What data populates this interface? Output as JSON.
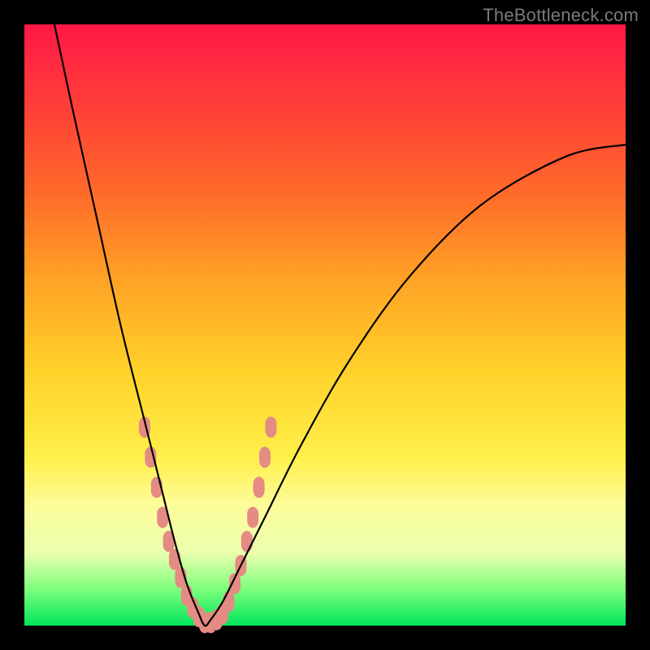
{
  "watermark": "TheBottleneck.com",
  "colors": {
    "gradient_top": "#ff1846",
    "gradient_bottom": "#00e55b",
    "curve": "#000000",
    "markers": "#e48b83",
    "frame": "#000000"
  },
  "chart_data": {
    "type": "line",
    "title": "",
    "xlabel": "",
    "ylabel": "",
    "xlim": [
      0,
      100
    ],
    "ylim": [
      0,
      100
    ],
    "note": "No numeric axis ticks or labels are rendered; values are normalized 0–100 in both axes. Curve is a V-shaped bottleneck profile with minimum near x≈30.",
    "series": [
      {
        "name": "bottleneck-curve",
        "x": [
          5,
          8,
          12,
          16,
          20,
          23,
          25,
          27,
          29,
          30,
          31,
          33,
          36,
          40,
          46,
          54,
          64,
          76,
          90,
          100
        ],
        "y": [
          100,
          86,
          68,
          50,
          34,
          22,
          14,
          7,
          2,
          0,
          1,
          4,
          10,
          18,
          30,
          44,
          58,
          70,
          78,
          80
        ]
      }
    ],
    "markers": {
      "name": "highlighted-points",
      "comment": "Salmon-colored rounded markers clustered along both arms near the trough.",
      "points": [
        {
          "x": 20,
          "y": 33
        },
        {
          "x": 21,
          "y": 28
        },
        {
          "x": 22,
          "y": 23
        },
        {
          "x": 23,
          "y": 18
        },
        {
          "x": 24,
          "y": 14
        },
        {
          "x": 25,
          "y": 11
        },
        {
          "x": 26,
          "y": 8
        },
        {
          "x": 27,
          "y": 5
        },
        {
          "x": 28,
          "y": 3
        },
        {
          "x": 29,
          "y": 1.5
        },
        {
          "x": 30,
          "y": 0.5
        },
        {
          "x": 31,
          "y": 0.5
        },
        {
          "x": 32,
          "y": 1
        },
        {
          "x": 33,
          "y": 2
        },
        {
          "x": 34,
          "y": 4
        },
        {
          "x": 35,
          "y": 7
        },
        {
          "x": 36,
          "y": 10
        },
        {
          "x": 37,
          "y": 14
        },
        {
          "x": 38,
          "y": 18
        },
        {
          "x": 39,
          "y": 23
        },
        {
          "x": 40,
          "y": 28
        },
        {
          "x": 41,
          "y": 33
        }
      ]
    }
  }
}
